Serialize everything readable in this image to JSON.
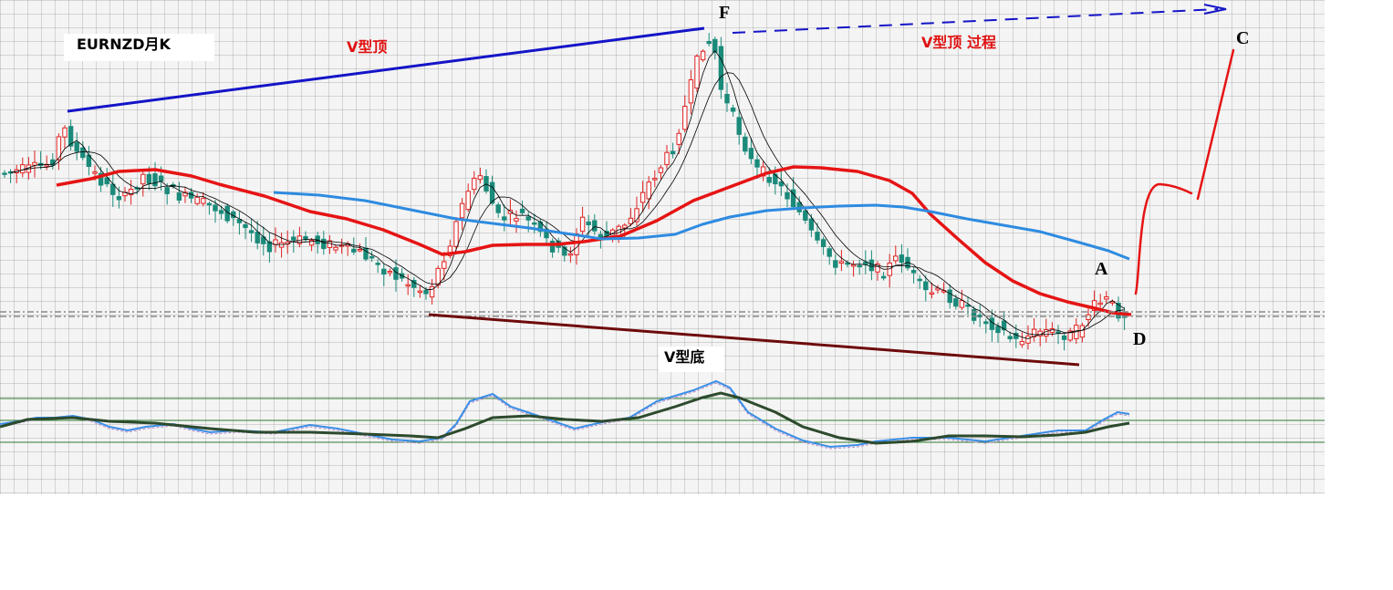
{
  "chart_data": {
    "type": "candlestick",
    "symbol_label": "EURNZD月K",
    "labels": {
      "v_top": "V型顶",
      "v_top_process": "V型顶 过程",
      "v_bottom": "V型底",
      "point_f": "F",
      "point_c": "C",
      "point_a": "A",
      "point_d": "D"
    },
    "colors": {
      "bull_candle": "#e02020",
      "bear_candle": "#1a8a7a",
      "ma_red": "#e61414",
      "ma_blue": "#2e8be0",
      "ma_thin": "#000000",
      "trend_top": "#1414c8",
      "trend_bottom": "#6e0a0a",
      "projection": "#e61414",
      "osc_fast": "#3a8ee6",
      "osc_slow": "#2d4a2d",
      "osc_ref": "#2f7a2f",
      "support_line": "#8a8a8a"
    },
    "legend": "none",
    "grid": true
  }
}
